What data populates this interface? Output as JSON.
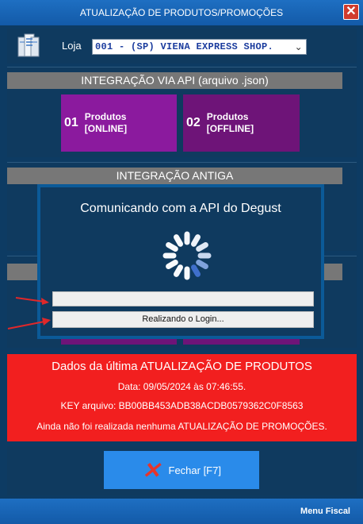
{
  "window": {
    "title": "ATUALIZAÇÃO DE PRODUTOS/PROMOÇÕES",
    "close_glyph": "✕"
  },
  "store": {
    "label": "Loja",
    "selected": "001 - (SP) VIENA EXPRESS SHOP.",
    "chevron": "⌄"
  },
  "api_panel": {
    "heading": "INTEGRAÇÃO VIA API (arquivo .json)",
    "buttons": [
      {
        "num": "01",
        "line1": "Produtos",
        "line2": "[ONLINE]",
        "color": "#8b1a9e"
      },
      {
        "num": "02",
        "line1": "Produtos",
        "line2": "[OFFLINE]",
        "color": "#6e1478"
      }
    ]
  },
  "legacy_panel": {
    "heading": "INTEGRAÇÃO ANTIGA"
  },
  "modal": {
    "message": "Comunicando com a API do Degust",
    "progress1_text": "",
    "progress2_text": "Realizando o Login..."
  },
  "info": {
    "title": "Dados da última ATUALIZAÇÃO DE PRODUTOS",
    "date": "Data: 09/05/2024 às 07:46:55.",
    "key": "KEY arquivo:  BB00BB453ADB38ACDB0579362C0F8563",
    "promo": "Ainda não foi realizada nenhuma ATUALIZAÇÃO DE PROMOÇÕES.",
    "bg_color": "#f21f1f"
  },
  "close_button": {
    "label": "Fechar [F7]",
    "icon": "x-icon"
  },
  "footer": {
    "menu_fiscal": "Menu Fiscal"
  },
  "colors": {
    "accent": "#1e6fc2",
    "panel": "#0f3a5f",
    "arrow": "#e0282a"
  }
}
